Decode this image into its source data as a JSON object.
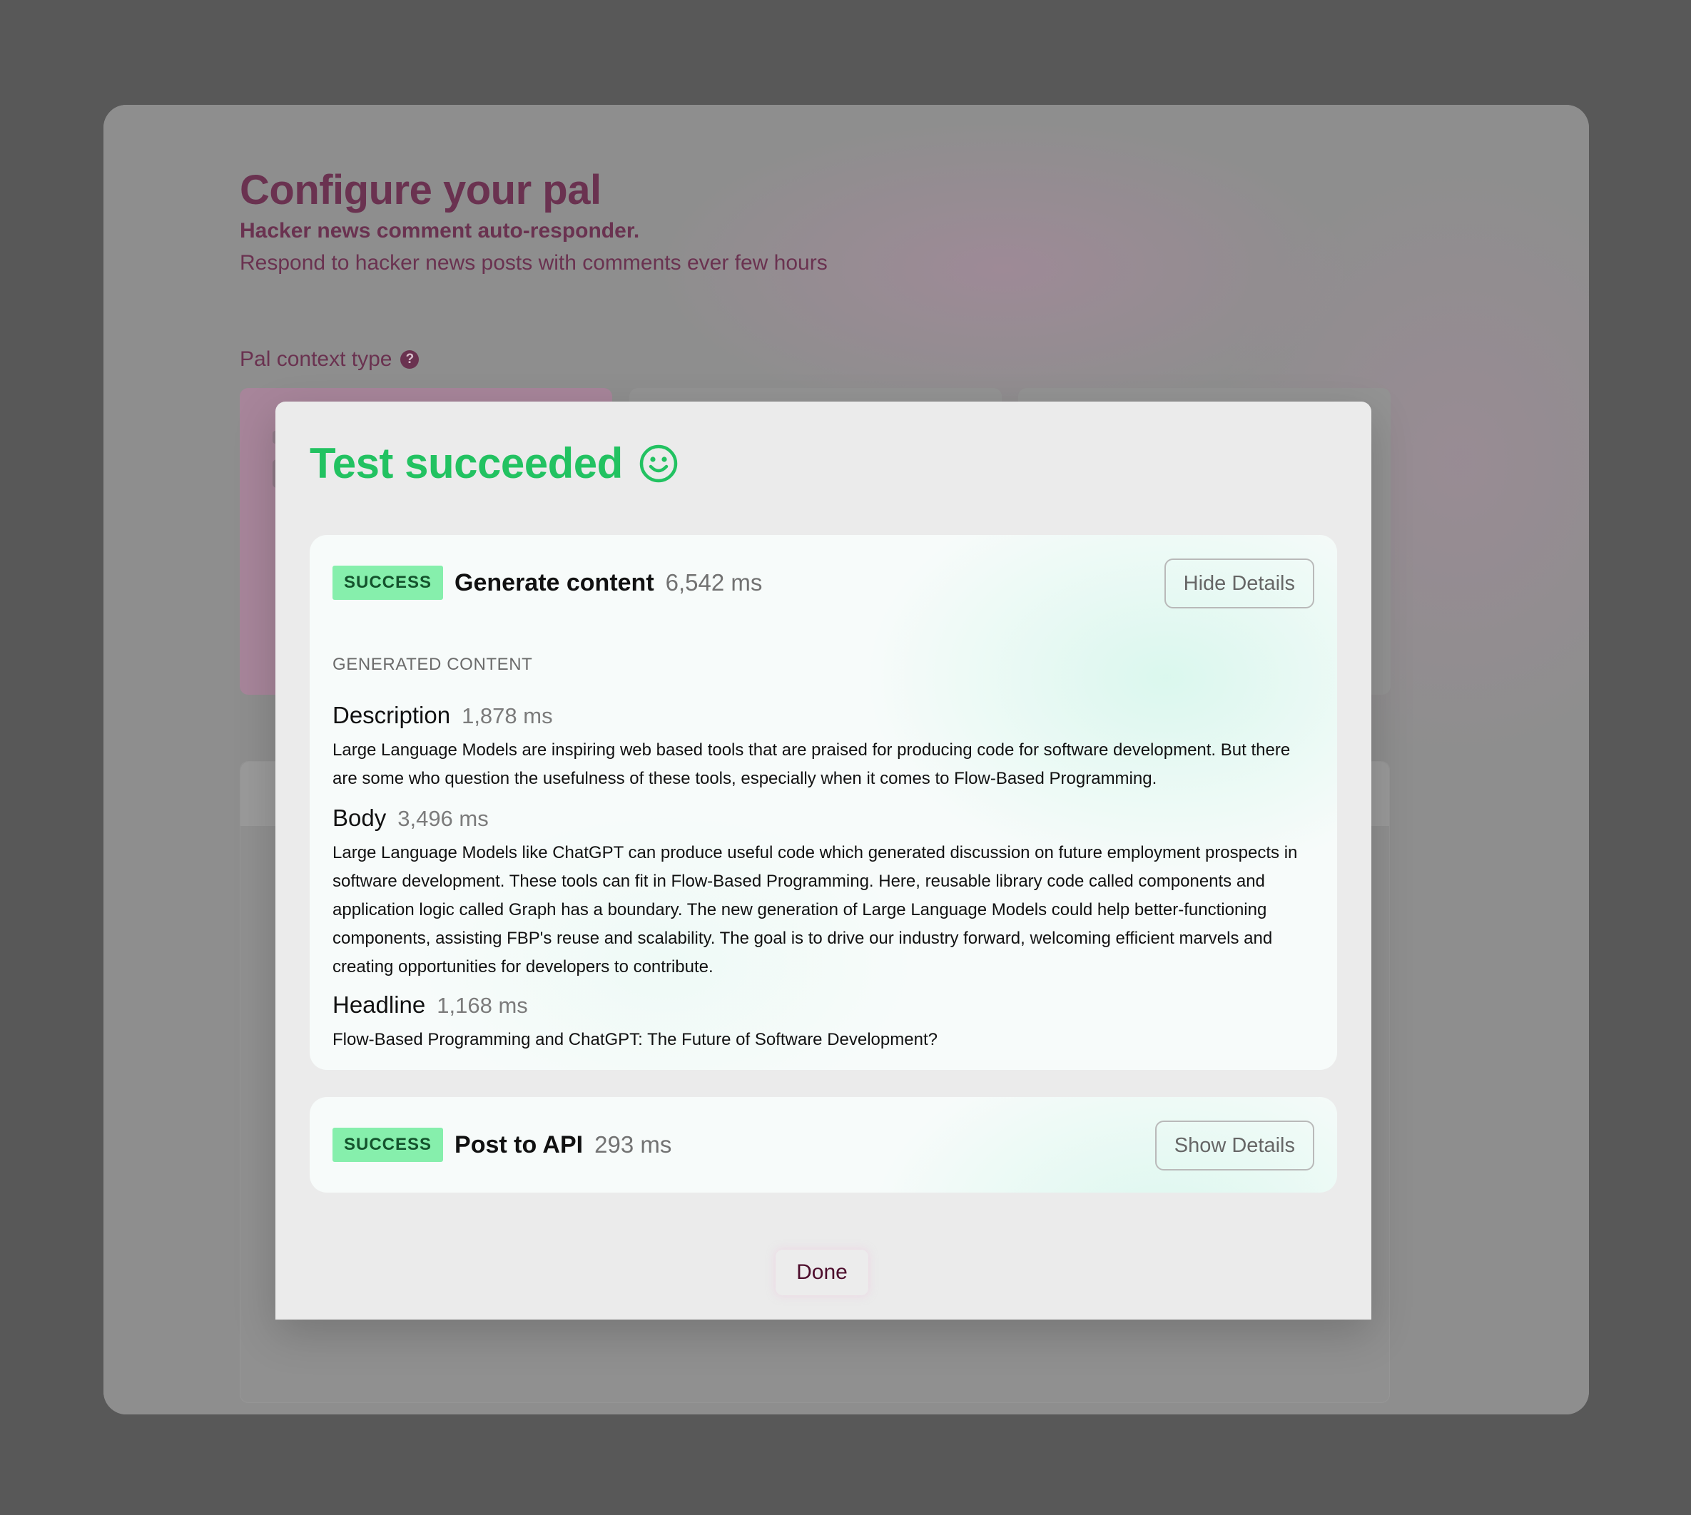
{
  "background": {
    "title": "Configure your pal",
    "subtitle": "Hacker news comment auto-responder.",
    "description": "Respond to hacker news posts with comments ever few hours",
    "context_type_label": "Pal context type",
    "help_icon": "?"
  },
  "modal": {
    "title": "Test succeeded",
    "title_icon": "smile-icon",
    "title_color": "#22c261",
    "steps": [
      {
        "status": "SUCCESS",
        "name": "Generate content",
        "time": "6,542 ms",
        "toggle_label": "Hide Details",
        "content_label": "GENERATED CONTENT",
        "fields": [
          {
            "name": "Description",
            "time": "1,878 ms",
            "text": "Large Language Models are inspiring web based tools that are praised for producing code for software development. But there are some who question the usefulness of these tools, especially when it comes to Flow-Based Programming."
          },
          {
            "name": "Body",
            "time": "3,496 ms",
            "text": "Large Language Models like ChatGPT can produce useful code which generated discussion on future employment prospects in software development. These tools can fit in Flow-Based Programming. Here, reusable library code called components and application logic called Graph has a boundary. The new generation of Large Language Models could help better-functioning components, assisting FBP's reuse and scalability. The goal is to drive our industry forward, welcoming efficient marvels and creating opportunities for developers to contribute."
          },
          {
            "name": "Headline",
            "time": "1,168 ms",
            "text": "Flow-Based Programming and ChatGPT: The Future of Software Development?"
          }
        ]
      },
      {
        "status": "SUCCESS",
        "name": "Post to API",
        "time": "293 ms",
        "toggle_label": "Show Details"
      }
    ],
    "done_label": "Done",
    "badge_color": "#86efac"
  }
}
